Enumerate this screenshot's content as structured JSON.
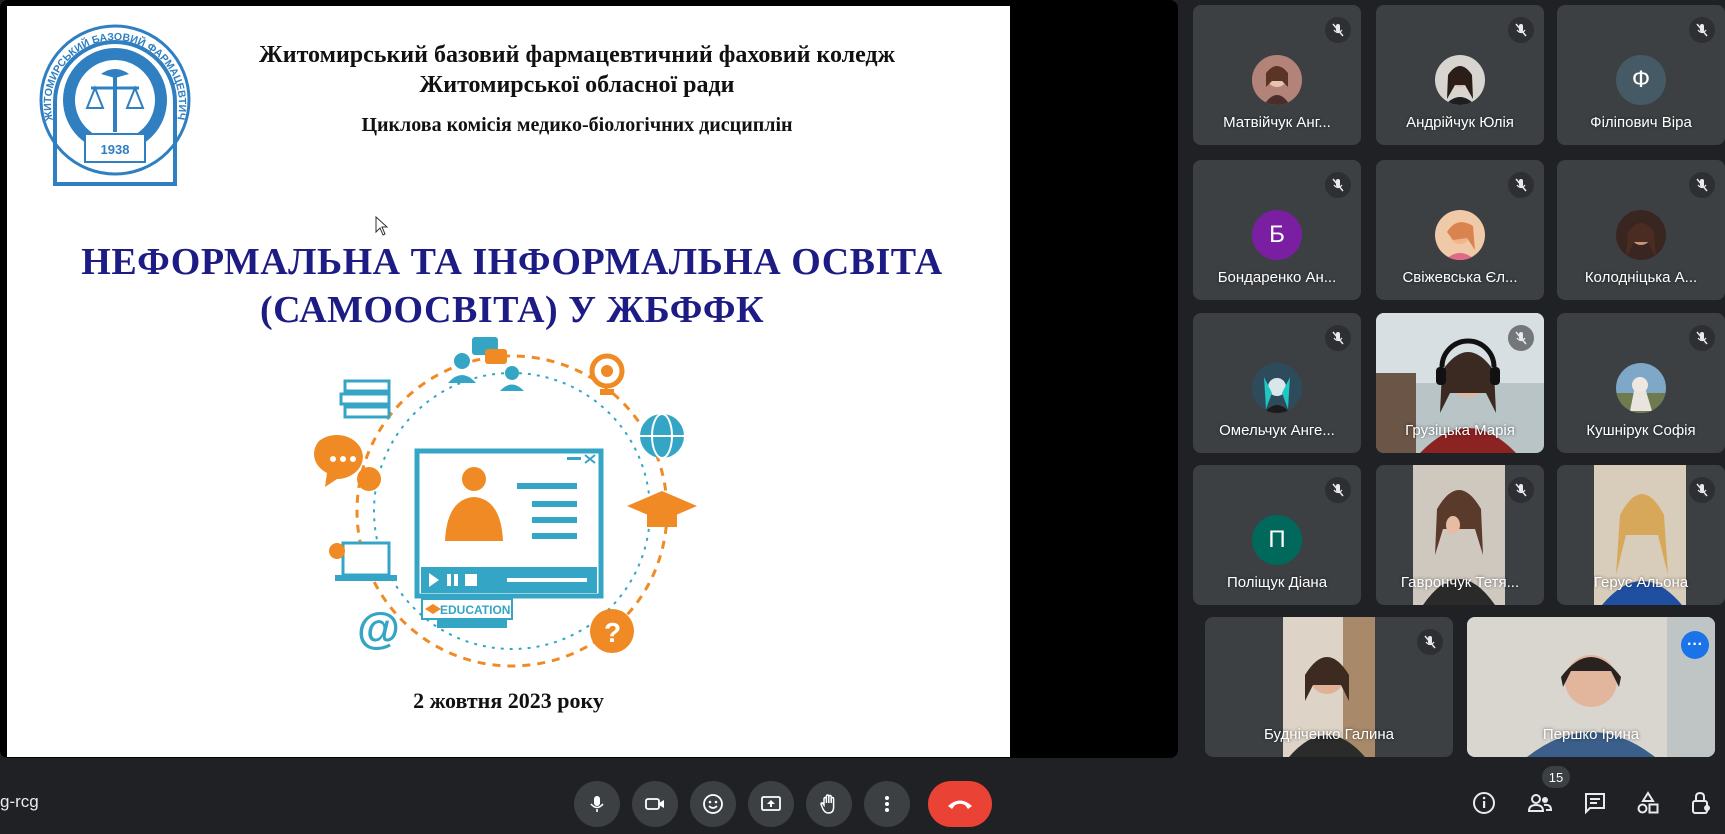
{
  "slide": {
    "header_line1": "Житомирський базовий фармацевтичний фаховий коледж",
    "header_line2": "Житомирської обласної ради",
    "commission": "Циклова комісія медико-біологічних дисциплін",
    "title_line1": "НЕФОРМАЛЬНА ТА ІНФОРМАЛЬНА ОСВІТА",
    "title_line2": "(САМООСВІТА) У ЖБФФК",
    "date": "2 жовтня 2023 року",
    "logo_ring_text": "ЖИТОМИРСЬКИЙ БАЗОВИЙ ФАРМАЦЕВТИЧНИЙ КОЛЕДЖ",
    "logo_year": "1938",
    "education_tag": "EDUCATION"
  },
  "participants": [
    {
      "name": "Матвійчук Анг...",
      "avatar": "photo",
      "muted": true
    },
    {
      "name": "Андрійчук Юлія",
      "avatar": "photo",
      "muted": true
    },
    {
      "name": "Філіпович Віра",
      "avatar": "letter",
      "letter": "Ф",
      "color": "#455a64",
      "muted": true
    },
    {
      "name": "Бондаренко Ан...",
      "avatar": "letter",
      "letter": "Б",
      "color": "#7b1fa2",
      "muted": true
    },
    {
      "name": "Свіжевська Єл...",
      "avatar": "photo",
      "muted": true
    },
    {
      "name": "Колодніцька А...",
      "avatar": "photo",
      "muted": true
    },
    {
      "name": "Омельчук Анге...",
      "avatar": "photo",
      "muted": true
    },
    {
      "name": "Грузіцька Марія",
      "avatar": "video",
      "muted": true
    },
    {
      "name": "Кушнірук Софія",
      "avatar": "photo",
      "muted": true
    },
    {
      "name": "Поліщук Діана",
      "avatar": "letter",
      "letter": "П",
      "color": "#00695c",
      "muted": true
    },
    {
      "name": "Гаврончук Тетя...",
      "avatar": "video",
      "muted": true
    },
    {
      "name": "Герус Альона",
      "avatar": "video",
      "muted": true
    },
    {
      "name": "Будніченко Галина",
      "avatar": "video",
      "muted": true
    },
    {
      "name": "Першко Ірина",
      "avatar": "video",
      "muted": false
    }
  ],
  "bottom_bar": {
    "meeting_code": "g-rcg",
    "participant_count": "15"
  },
  "colors": {
    "background": "#202124",
    "tile": "#3c4043",
    "hangup": "#ea4335",
    "accent": "#8ab4f8",
    "title": "#1d1b84"
  }
}
